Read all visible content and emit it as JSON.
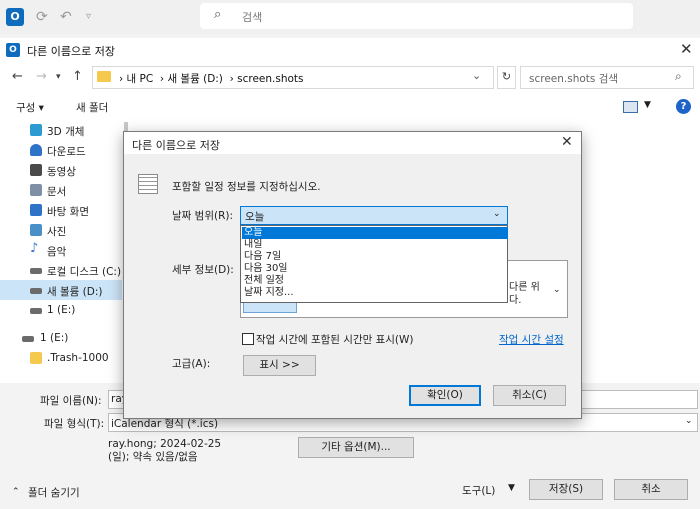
{
  "outlook": {
    "logo": "O",
    "search_placeholder": "검색"
  },
  "window": {
    "title": "다른 이름으로 저장",
    "path": [
      "내 PC",
      "새 볼륨 (D:)",
      "screen.shots"
    ],
    "search_placeholder": "screen.shots 검색"
  },
  "toolbar": {
    "organize": "구성 ▾",
    "new_folder": "새 폴더"
  },
  "sidebar": {
    "items": [
      {
        "label": "3D 개체",
        "color": "#2d9bd2"
      },
      {
        "label": "다운로드",
        "color": "#2f73c9"
      },
      {
        "label": "동영상",
        "color": "#4a4a4a"
      },
      {
        "label": "문서",
        "color": "#7f8fa6"
      },
      {
        "label": "바탕 화면",
        "color": "#2f73c9"
      },
      {
        "label": "사진",
        "color": "#4a90c8"
      },
      {
        "label": "음악",
        "color": "#2f73c9"
      },
      {
        "label": "로컬 디스크 (C:)",
        "color": "#6b6b6b"
      },
      {
        "label": "새 볼륨 (D:)",
        "color": "#6b6b6b"
      },
      {
        "label": "1 (E:)",
        "color": "#6b6b6b"
      },
      {
        "label": "1 (E:)",
        "color": "#6b6b6b"
      },
      {
        "label": ".Trash-1000",
        "color": "#f4c94e"
      }
    ]
  },
  "bottom": {
    "filename_label": "파일 이름(N):",
    "filename_value": "ray",
    "filetype_label": "파일 형식(T):",
    "filetype_value": "iCalendar 형식 (*.ics)",
    "summary": "ray.hong; 2024-02-25 (일); 약속 있음/없음",
    "more_options": "기타 옵션(M)...",
    "hide_folders": "폴더 숨기기",
    "tools": "도구(L)",
    "save": "저장(S)",
    "cancel": "취소"
  },
  "dialog": {
    "title": "다른 이름으로 저장",
    "instruction": "포함할 일정 정보를 지정하십시오.",
    "date_range_label": "날짜 범위(R):",
    "date_range_value": "오늘",
    "date_options": [
      "오늘",
      "내일",
      "다음 7일",
      "다음 30일",
      "전체 일정",
      "날짜 지정..."
    ],
    "details_label": "세부 정보(D):",
    "details_note": "다른 위 다.",
    "worktime_label": "작업 시간에 포함된 시간만 표시(W)",
    "worktime_link": "작업 시간 설정",
    "advanced_label": "고급(A):",
    "show_button": "표시 >>",
    "ok_button": "확인(O)",
    "cancel_button": "취소(C)"
  }
}
